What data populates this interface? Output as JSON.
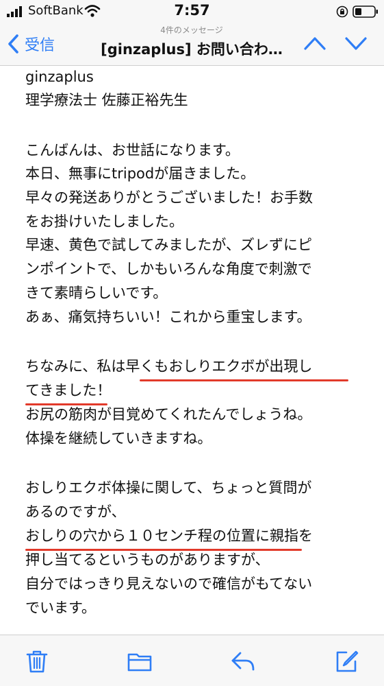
{
  "status_bar": {
    "carrier": "SoftBank",
    "time": "7:57"
  },
  "nav": {
    "back_label": "受信",
    "subtitle": "4件のメッセージ",
    "title": "[ginzaplus] お問い合わ…"
  },
  "email": {
    "lines": [
      "ginzaplus",
      "理学療法士 佐藤正裕先生",
      "",
      "こんばんは、お世話になります。",
      "本日、無事にtripodが届きました。",
      "早々の発送ありがとうございました！お手数",
      "をお掛けいたしました。",
      "早速、黄色で試してみましたが、ズレずにピ",
      "ンポイントで、しかもいろんな角度で刺激で",
      "きて素晴らしいです。",
      "あぁ、痛気持ちいい！これから重宝します。",
      "",
      "ちなみに、私は早くもおしりエクボが出現し",
      "てきました！",
      "お尻の筋肉が目覚めてくれたんでしょうね。",
      "体操を継続していきますね。",
      "",
      "おしりエクボ体操に関して、ちょっと質問が",
      "あるのですが、",
      "おしりの穴から１０センチ程の位置に親指を",
      "押し当てるというものがありますが、",
      "自分ではっきり見えないので確信がもてない",
      "でいます。"
    ]
  },
  "colors": {
    "accent": "#2f7ef6",
    "underline": "#e23a2a"
  },
  "toolbar_icons": [
    "trash-icon",
    "folder-icon",
    "reply-icon",
    "compose-icon"
  ]
}
